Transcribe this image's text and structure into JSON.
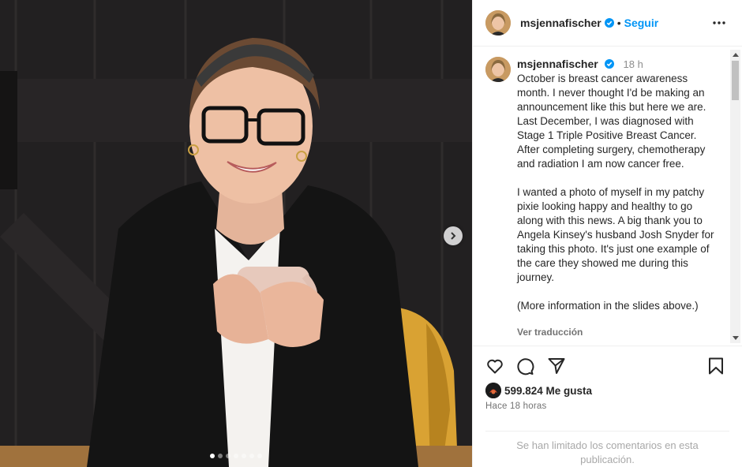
{
  "photo": {
    "carousel_dots": 7,
    "active_dot": 0,
    "next_icon": "chevron-right-icon"
  },
  "header": {
    "username": "msjennafischer",
    "verified_icon": "verified-badge-icon",
    "separator": "•",
    "follow_label": "Seguir",
    "more_icon": "more-options-icon"
  },
  "caption": {
    "username": "msjennafischer",
    "time": "18 h",
    "paragraphs": [
      "October is breast cancer awareness month. I never thought I'd be making an announcement like this but here we are. Last December, I was diagnosed with Stage 1 Triple Positive Breast Cancer. After completing surgery, chemotherapy and radiation I am now cancer free.",
      "I wanted a photo of myself in my patchy pixie looking happy and healthy to go along with this news. A big thank you to Angela Kinsey's husband Josh Snyder for taking this photo. It's just one example of the care they showed me during this journey.",
      "(More information in the slides above.)"
    ],
    "see_translation": "Ver traducción"
  },
  "actions": {
    "like_icon": "heart-icon",
    "comment_icon": "comment-icon",
    "share_icon": "share-icon",
    "save_icon": "bookmark-icon"
  },
  "likes": {
    "count_text": "599.824 Me gusta"
  },
  "posted_ago": "Hace 18 horas",
  "comments_limited": "Se han limitado los comentarios en esta publicación.",
  "colors": {
    "accent": "#0095f6",
    "verified": "#0095f6",
    "text": "#262626",
    "muted": "#737373"
  }
}
